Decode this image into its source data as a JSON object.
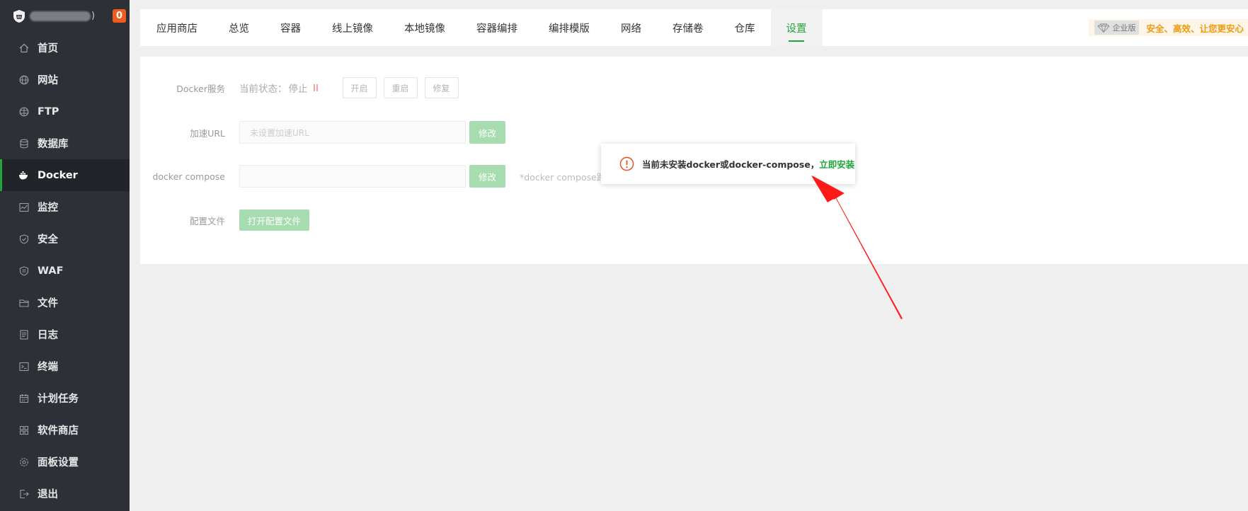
{
  "sidebar": {
    "brand_tail": ")",
    "badge_count": "0",
    "items": [
      {
        "label": "首页",
        "icon": "home-icon"
      },
      {
        "label": "网站",
        "icon": "globe-icon"
      },
      {
        "label": "FTP",
        "icon": "ftp-icon"
      },
      {
        "label": "数据库",
        "icon": "database-icon"
      },
      {
        "label": "Docker",
        "icon": "docker-icon",
        "active": true
      },
      {
        "label": "监控",
        "icon": "monitor-icon"
      },
      {
        "label": "安全",
        "icon": "shield-icon"
      },
      {
        "label": "WAF",
        "icon": "waf-icon"
      },
      {
        "label": "文件",
        "icon": "folder-icon"
      },
      {
        "label": "日志",
        "icon": "log-icon"
      },
      {
        "label": "终端",
        "icon": "terminal-icon"
      },
      {
        "label": "计划任务",
        "icon": "calendar-icon"
      },
      {
        "label": "软件商店",
        "icon": "apps-icon"
      },
      {
        "label": "面板设置",
        "icon": "gear-icon"
      },
      {
        "label": "退出",
        "icon": "logout-icon"
      }
    ]
  },
  "tabs": [
    {
      "label": "应用商店"
    },
    {
      "label": "总览"
    },
    {
      "label": "容器"
    },
    {
      "label": "线上镜像"
    },
    {
      "label": "本地镜像"
    },
    {
      "label": "容器编排"
    },
    {
      "label": "编排模版"
    },
    {
      "label": "网络"
    },
    {
      "label": "存储卷"
    },
    {
      "label": "仓库"
    },
    {
      "label": "设置",
      "active": true
    }
  ],
  "enterprise": {
    "badge": "企业版",
    "slogan": "安全、高效、让您更安心"
  },
  "settings": {
    "docker_service": {
      "label": "Docker服务",
      "status_label": "当前状态：",
      "status_value": "停止",
      "start_button": "开启",
      "restart_button": "重启",
      "repair_button": "修复"
    },
    "mirror_url": {
      "label": "加速URL",
      "placeholder": "未设置加速URL",
      "edit_button": "修改"
    },
    "docker_compose": {
      "label": "docker compose",
      "value": "",
      "edit_button": "修改",
      "hint": "*docker compose路径"
    },
    "config_file": {
      "label": "配置文件",
      "open_button": "打开配置文件"
    }
  },
  "popup": {
    "message": "当前未安装docker或docker-compose，",
    "install_link": "立即安装"
  },
  "colors": {
    "sidebar_bg": "#2d3137",
    "accent_green": "#20a53a",
    "badge_orange": "#f05b1f",
    "slogan_orange": "#ee9a10",
    "annotation_arrow": "#ff1a1a"
  }
}
